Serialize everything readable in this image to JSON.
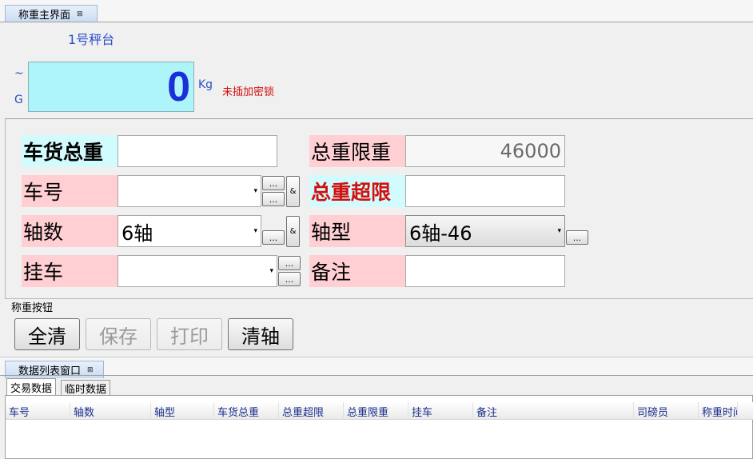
{
  "top_panel": {
    "tab_title": "称重主界面",
    "tab_close": "⊠"
  },
  "scale": {
    "platform_name": "1号秤台",
    "tilde": "~",
    "g_letter": "G",
    "weight": "0",
    "unit": "Kg",
    "dongle_status": "未插加密锁"
  },
  "form": {
    "gross_weight": {
      "label": "车货总重",
      "value": ""
    },
    "gross_limit": {
      "label": "总重限重",
      "value": "46000"
    },
    "plate": {
      "label": "车号",
      "value": ""
    },
    "overweight": {
      "label": "总重超限",
      "value": ""
    },
    "axle_count": {
      "label": "轴数",
      "value": "6轴"
    },
    "axle_type": {
      "label": "轴型",
      "value": "6轴-46"
    },
    "trailer": {
      "label": "挂车",
      "value": ""
    },
    "remark": {
      "label": "备注",
      "value": ""
    },
    "ellipsis": "...",
    "amp": "&",
    "dropdown_arrow": "▾"
  },
  "buttons": {
    "group_title": "称重按钮",
    "clear_all": "全清",
    "save": "保存",
    "print": "打印",
    "clear_axle": "清轴"
  },
  "list_panel": {
    "tab_title": "数据列表窗口",
    "tab_close": "⊠",
    "tabs": [
      "交易数据",
      "临时数据"
    ],
    "columns": [
      "车号",
      "轴数",
      "轴型",
      "车货总重",
      "总重超限",
      "总重限重",
      "挂车",
      "备注",
      "司磅员",
      "称重时间"
    ]
  },
  "colors": {
    "weight_text": "#1a2fd8",
    "weight_bg": "#aef4fb",
    "alert_text": "#d21010",
    "label_pink": "#ffcfd4",
    "label_cyan": "#d2fbfd"
  }
}
